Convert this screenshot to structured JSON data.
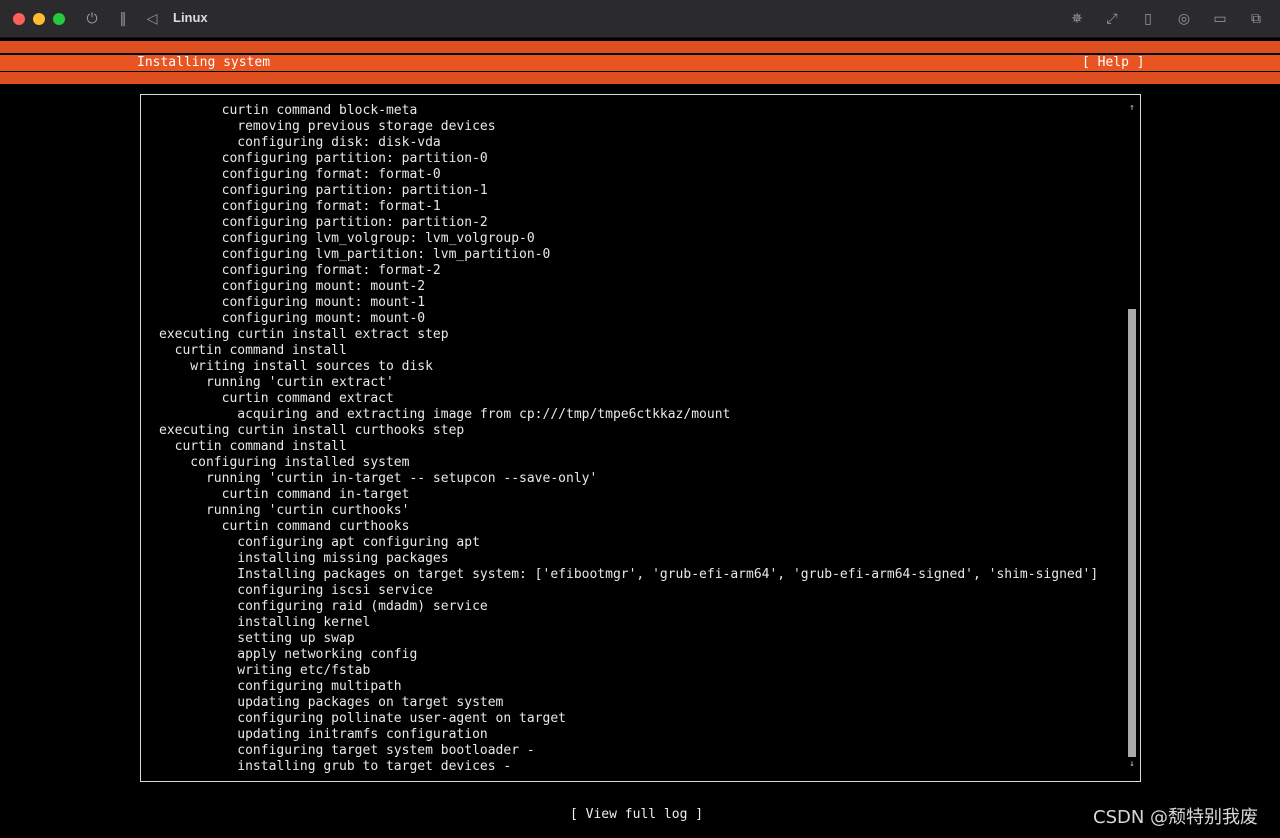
{
  "window": {
    "title": "Linux",
    "toolbar_left_icons": [
      "power-icon",
      "pause-icon",
      "back-icon"
    ],
    "toolbar_right_icons": [
      "brightness-icon",
      "resize-icon",
      "usb-icon",
      "disc-icon",
      "folder-icon",
      "windows-icon"
    ]
  },
  "header": {
    "title": "Installing system",
    "help_label": "[ Help ]",
    "color": "#e95420"
  },
  "log": {
    "lines": [
      "        curtin command block-meta",
      "          removing previous storage devices",
      "          configuring disk: disk-vda",
      "        configuring partition: partition-0",
      "        configuring format: format-0",
      "        configuring partition: partition-1",
      "        configuring format: format-1",
      "        configuring partition: partition-2",
      "        configuring lvm_volgroup: lvm_volgroup-0",
      "        configuring lvm_partition: lvm_partition-0",
      "        configuring format: format-2",
      "        configuring mount: mount-2",
      "        configuring mount: mount-1",
      "        configuring mount: mount-0",
      "executing curtin install extract step",
      "  curtin command install",
      "    writing install sources to disk",
      "      running 'curtin extract'",
      "        curtin command extract",
      "          acquiring and extracting image from cp:///tmp/tmpe6ctkkaz/mount",
      "executing curtin install curthooks step",
      "  curtin command install",
      "    configuring installed system",
      "      running 'curtin in-target -- setupcon --save-only'",
      "        curtin command in-target",
      "      running 'curtin curthooks'",
      "        curtin command curthooks",
      "          configuring apt configuring apt",
      "          installing missing packages",
      "          Installing packages on target system: ['efibootmgr', 'grub-efi-arm64', 'grub-efi-arm64-signed', 'shim-signed']",
      "          configuring iscsi service",
      "          configuring raid (mdadm) service",
      "          installing kernel",
      "          setting up swap",
      "          apply networking config",
      "          writing etc/fstab",
      "          configuring multipath",
      "          updating packages on target system",
      "          configuring pollinate user-agent on target",
      "          updating initramfs configuration",
      "          configuring target system bootloader -",
      "          installing grub to target devices -"
    ]
  },
  "footer": {
    "view_log_label": "[ View full log ]",
    "watermark": "CSDN @颓特别我废"
  }
}
